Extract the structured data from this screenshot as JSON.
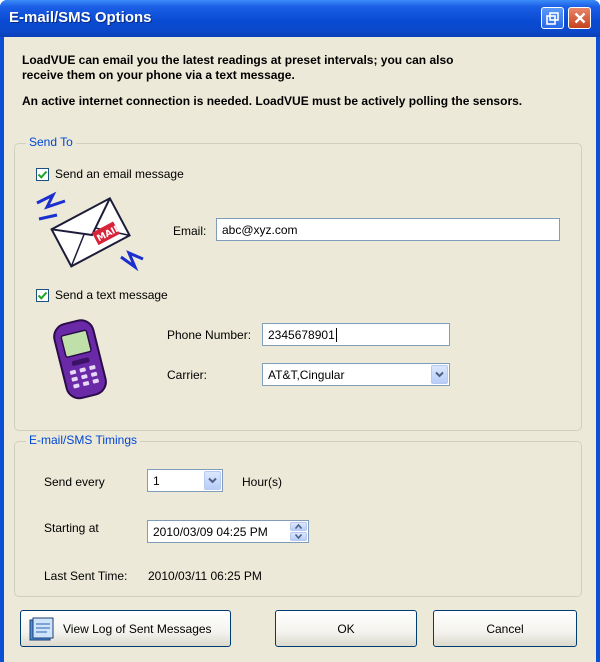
{
  "window": {
    "title": "E-mail/SMS Options"
  },
  "intro": {
    "line1": "LoadVUE can email you the latest readings at preset intervals; you can also",
    "line2": "receive them on your phone via a text message.",
    "line3": "An active internet connection is needed. LoadVUE must be actively polling the sensors."
  },
  "send_to": {
    "group_label": "Send To",
    "email_check_label": "Send an email message",
    "email_checked": true,
    "email_label": "Email:",
    "email_value": "abc@xyz.com",
    "email_icon_text": "MAIL",
    "sms_check_label": "Send a text message",
    "sms_checked": true,
    "phone_label": "Phone Number:",
    "phone_value": "2345678901",
    "carrier_label": "Carrier:",
    "carrier_value": "AT&T,Cingular"
  },
  "timings": {
    "group_label": "E-mail/SMS Timings",
    "send_every_label": "Send every",
    "send_every_value": "1",
    "send_every_unit": "Hour(s)",
    "starting_at_label": "Starting at",
    "starting_at_value": "2010/03/09 04:25 PM",
    "last_sent_label": "Last Sent Time:",
    "last_sent_value": "2010/03/11 06:25 PM"
  },
  "buttons": {
    "view_log": "View Log of Sent Messages",
    "ok": "OK",
    "cancel": "Cancel"
  },
  "colors": {
    "title_bar": "#0a4bd3",
    "group_label": "#0046d5",
    "dialog_bg": "#ece9d8"
  }
}
